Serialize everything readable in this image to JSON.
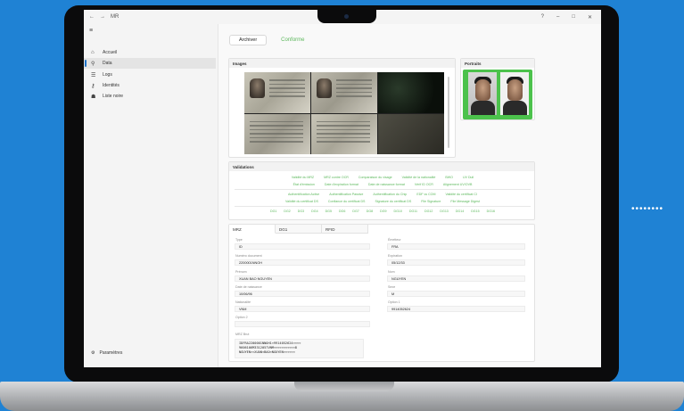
{
  "window": {
    "title": "MR",
    "back": "←",
    "forward": "→",
    "help": "?",
    "minimize": "–",
    "maximize": "□",
    "close": "✕"
  },
  "sidebar": {
    "menu": "≡",
    "items": [
      {
        "label": "Accueil",
        "icon": "home-icon",
        "glyph": "⌂"
      },
      {
        "label": "Data",
        "icon": "search-icon",
        "glyph": "⚲"
      },
      {
        "label": "Logs",
        "icon": "logs-icon",
        "glyph": "☰"
      },
      {
        "label": "Identités",
        "icon": "identity-icon",
        "glyph": "⚷"
      },
      {
        "label": "Liste noire",
        "icon": "blacklist-icon",
        "glyph": "☗"
      }
    ],
    "settings": {
      "label": "Paramètres",
      "glyph": "⚙"
    }
  },
  "tabs": {
    "archive": "Archiver",
    "status": "Conforme"
  },
  "images_panel": {
    "title": "Images"
  },
  "portraits_panel": {
    "title": "Portraits"
  },
  "validations": {
    "title": "Validations",
    "row1": [
      "Validité du MRZ",
      "MRZ contre OCR",
      "Comparaison du visage",
      "Validité de la nationalité",
      "BWO",
      "UV Dull"
    ],
    "row2": [
      "État d'émission",
      "Date d'expiration format",
      "Date de naissance format",
      "Vérif ID OCR",
      "Alignement UV/OVB"
    ],
    "row3": [
      "Authentification Active",
      "Authentification Passive",
      "Authentification du Chip",
      "EDF vs COM",
      "Validité du certificat CI"
    ],
    "row4": [
      "Validité du certificat DS",
      "Confiance du certificat DS",
      "Signature du certificat DS",
      "File Signature",
      "File Message Digest"
    ],
    "row5": [
      "DG1",
      "DG2",
      "DG3",
      "DG4",
      "DG5",
      "DG6",
      "DG7",
      "DG8",
      "DG9",
      "DG10",
      "DG11",
      "DG12",
      "DG13",
      "DG14",
      "DG15",
      "DG16"
    ]
  },
  "mrz": {
    "tabs": [
      "MRZ",
      "DG1",
      "RFID"
    ],
    "fields": [
      {
        "label": "Type",
        "value": "ID"
      },
      {
        "label": "Numéro document",
        "value": "2200001NNOH"
      },
      {
        "label": "Prénom",
        "value": "XUAN BAO NGUYEN"
      },
      {
        "label": "Date de naissance",
        "value": "10/06/96"
      },
      {
        "label": "Nationalité",
        "value": "VNM"
      },
      {
        "label": "Option 2",
        "value": ""
      }
    ],
    "fields_right": [
      {
        "label": "Émetteur",
        "value": "FRA"
      },
      {
        "label": "Expiration",
        "value": "05/12/33"
      },
      {
        "label": "Nom",
        "value": "NGUYEN"
      },
      {
        "label": "Sexe",
        "value": "M"
      },
      {
        "label": "Option 1",
        "value": "9914052624"
      }
    ],
    "raw_label": "MRZ Brut",
    "raw": "IDFRA2200001NNOH1<9914052624<<<<\n9606106M3312057VNM<<<<<<<<<<<8\nNGUYEN<<XUAN<BAO<NGUYEN<<<<<<"
  },
  "colors": {
    "accent": "#1f73c8",
    "valid": "#5cb85c",
    "background": "#1f82d4"
  }
}
